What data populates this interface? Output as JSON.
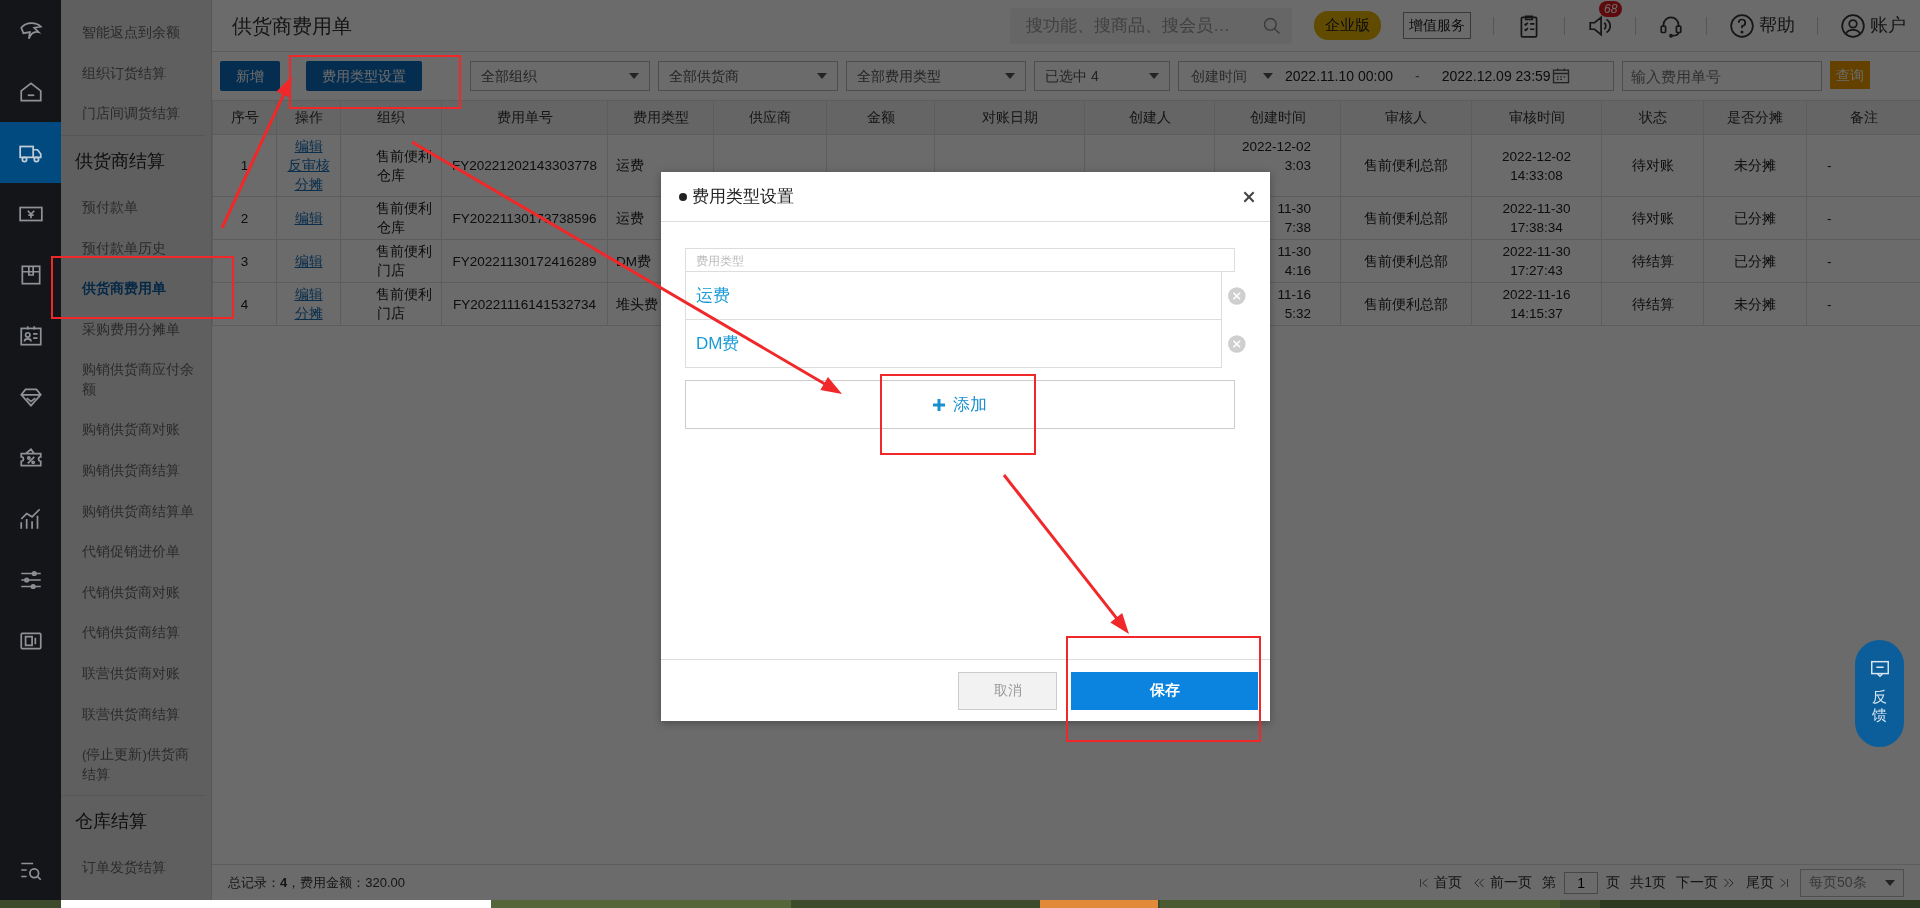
{
  "rail": {
    "items": [
      {
        "kind": "logo",
        "selected": false
      },
      {
        "kind": "home",
        "selected": false
      },
      {
        "kind": "truck",
        "selected": true
      },
      {
        "kind": "yen",
        "selected": false
      },
      {
        "kind": "box",
        "selected": false
      },
      {
        "kind": "card",
        "selected": false
      },
      {
        "kind": "diamond",
        "selected": false
      },
      {
        "kind": "ticket",
        "selected": false
      },
      {
        "kind": "chart",
        "selected": false
      },
      {
        "kind": "sliders",
        "selected": false
      },
      {
        "kind": "register",
        "selected": false
      }
    ],
    "bottom": {
      "kind": "search-list",
      "selected": false
    }
  },
  "sidebar": {
    "items": [
      {
        "kind": "item",
        "label": "智能返点到余额",
        "selected": false
      },
      {
        "kind": "item",
        "label": "组织订货结算",
        "selected": false
      },
      {
        "kind": "item",
        "label": "门店间调货结算",
        "selected": false
      },
      {
        "kind": "heading",
        "label": "供货商结算"
      },
      {
        "kind": "item",
        "label": "预付款单",
        "selected": false
      },
      {
        "kind": "item",
        "label": "预付款单历史",
        "selected": false
      },
      {
        "kind": "item",
        "label": "供货商费用单",
        "selected": true
      },
      {
        "kind": "item",
        "label": "采购费用分摊单",
        "selected": false
      },
      {
        "kind": "item",
        "label": "购销供货商应付余额",
        "selected": false
      },
      {
        "kind": "item",
        "label": "购销供货商对账",
        "selected": false
      },
      {
        "kind": "item",
        "label": "购销供货商结算",
        "selected": false
      },
      {
        "kind": "item",
        "label": "购销供货商结算单",
        "selected": false
      },
      {
        "kind": "item",
        "label": "代销促销进价单",
        "selected": false
      },
      {
        "kind": "item",
        "label": "代销供货商对账",
        "selected": false
      },
      {
        "kind": "item",
        "label": "代销供货商结算",
        "selected": false
      },
      {
        "kind": "item",
        "label": "联营供货商对账",
        "selected": false
      },
      {
        "kind": "item",
        "label": "联营供货商结算",
        "selected": false
      },
      {
        "kind": "item",
        "label": "(停止更新)供货商结算",
        "selected": false
      },
      {
        "kind": "heading",
        "label": "仓库结算"
      },
      {
        "kind": "item",
        "label": "订单发货结算",
        "selected": false
      }
    ]
  },
  "header": {
    "title": "供货商费用单",
    "search": {
      "placeholder": "搜功能、搜商品、搜会员…"
    },
    "edition": "企业版",
    "value_added": "增值服务",
    "notification_count": "68",
    "help": "帮助",
    "account": "账户"
  },
  "toolbar": {
    "buttons": [
      "新增",
      "费用类型设置"
    ],
    "filters": [
      {
        "value": "全部组织"
      },
      {
        "value": "全部供货商"
      },
      {
        "value": "全部费用类型"
      },
      {
        "value": "已选中 4"
      }
    ],
    "date_filter": {
      "field": "创建时间",
      "start": "2022.11.10 00:00",
      "separator": "-",
      "end": "2022.12.09 23:59"
    },
    "search": {
      "placeholder": "输入费用单号"
    },
    "query": "查询"
  },
  "table": {
    "columns": [
      "序号",
      "操作",
      "组织",
      "费用单号",
      "费用类型",
      "供应商",
      "金额",
      "对账日期",
      "创建人",
      "创建时间",
      "审核人",
      "审核时间",
      "状态",
      "是否分摊",
      "备注"
    ],
    "rows": [
      {
        "index": "1",
        "actions": [
          "编辑",
          "反审核",
          "分摊"
        ],
        "org": "售前便利仓库",
        "number": "FY20221202143303778",
        "type": "运费",
        "created_time": [
          "2022-12-02",
          "3:03"
        ],
        "reviewer": "售前便利总部",
        "review_time": [
          "2022-12-02",
          "14:33:08"
        ],
        "status": "待对账",
        "allocated": "未分摊",
        "note": "-"
      },
      {
        "index": "2",
        "actions": [
          "编辑"
        ],
        "org": "售前便利仓库",
        "number": "FY20221130173738596",
        "type": "运费",
        "created_time": [
          "11-30",
          "7:38"
        ],
        "reviewer": "售前便利总部",
        "review_time": [
          "2022-11-30",
          "17:38:34"
        ],
        "status": "待对账",
        "allocated": "已分摊",
        "note": "-"
      },
      {
        "index": "3",
        "actions": [
          "编辑"
        ],
        "org": "售前便利门店",
        "number": "FY20221130172416289",
        "type": "DM费",
        "created_time": [
          "11-30",
          "4:16"
        ],
        "reviewer": "售前便利总部",
        "review_time": [
          "2022-11-30",
          "17:27:43"
        ],
        "status": "待结算",
        "allocated": "已分摊",
        "note": "-"
      },
      {
        "index": "4",
        "actions": [
          "编辑",
          "分摊"
        ],
        "org": "售前便利门店",
        "number": "FY20221116141532734",
        "type": "堆头费",
        "created_time": [
          "11-16",
          "5:32"
        ],
        "reviewer": "售前便利总部",
        "review_time": [
          "2022-11-16",
          "14:15:37"
        ],
        "status": "待结算",
        "allocated": "未分摊",
        "note": "-"
      }
    ]
  },
  "footer": {
    "summary": "总记录：**4**，费用金额：320.00",
    "pagination": {
      "first": "首页",
      "prev": "前一页",
      "page_before": "第",
      "page": "1",
      "page_after": "页",
      "total": "共1页",
      "next": "下一页",
      "last": "尾页",
      "page_size": "每页50条"
    }
  },
  "feedback": {
    "label": "反馈"
  },
  "modal": {
    "title": "费用类型设置",
    "list_header": "费用类型",
    "items": [
      {
        "value": "运费"
      },
      {
        "value": "DM费"
      }
    ],
    "add": "添加",
    "cancel": {
      "label": "取消",
      "disabled": true
    },
    "save": "保存"
  }
}
